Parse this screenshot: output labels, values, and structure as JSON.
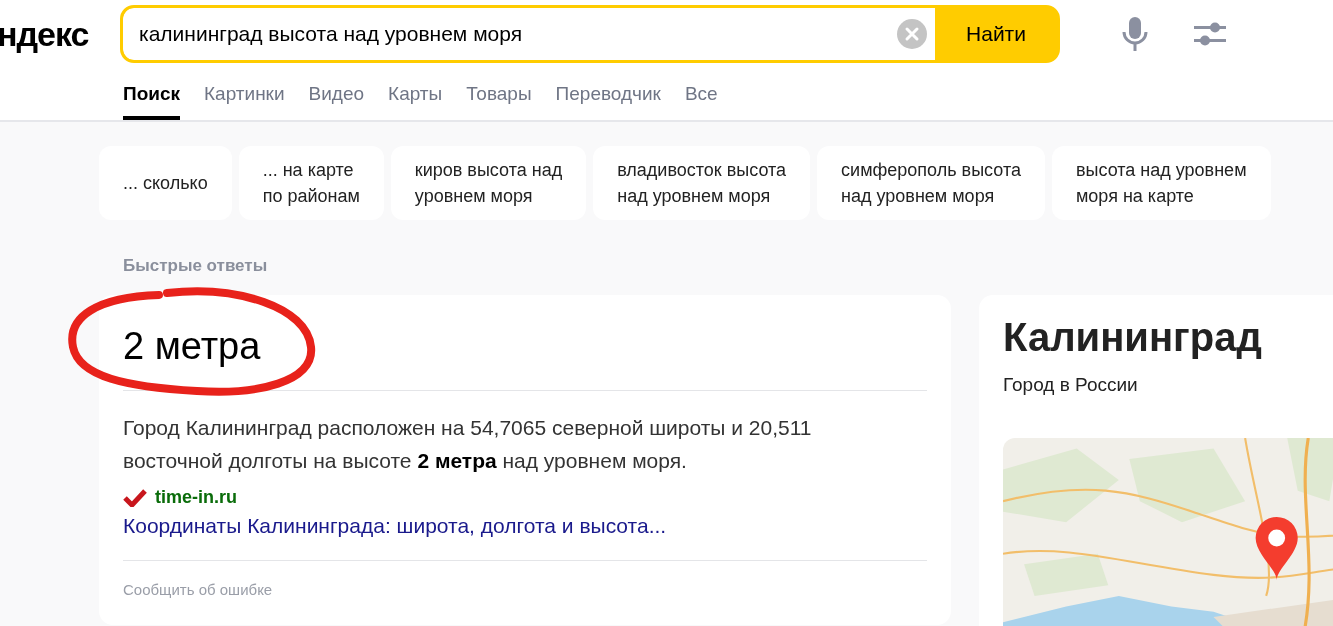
{
  "logo": "ндекс",
  "search": {
    "value": "калининград высота над уровнем моря",
    "button": "Найти"
  },
  "tabs": [
    {
      "label": "Поиск",
      "selected": true
    },
    {
      "label": "Картинки",
      "selected": false
    },
    {
      "label": "Видео",
      "selected": false
    },
    {
      "label": "Карты",
      "selected": false
    },
    {
      "label": "Товары",
      "selected": false
    },
    {
      "label": "Переводчик",
      "selected": false
    },
    {
      "label": "Все",
      "selected": false
    }
  ],
  "suggestions": [
    {
      "lines": [
        "... сколько"
      ]
    },
    {
      "lines": [
        "... на карте",
        "по районам"
      ]
    },
    {
      "lines": [
        "киров высота над",
        "уровнем моря"
      ]
    },
    {
      "lines": [
        "владивосток высота",
        "над уровнем моря"
      ]
    },
    {
      "lines": [
        "симферополь высота",
        "над уровнем моря"
      ]
    },
    {
      "lines": [
        "высота над уровнем",
        "моря на карте"
      ]
    }
  ],
  "section_title": "Быстрые ответы",
  "answer": {
    "value": "2 метра",
    "circled": true,
    "text": "Город Калининград расположен на 54,7065 северной широты и 20,511 восточной долготы на высоте **2 метра** над уровнем моря.",
    "source": "time-in.ru",
    "link": "Координаты Калининграда: широта, долгота и высота...",
    "report": "Сообщить об ошибке"
  },
  "entity": {
    "title": "Калининград",
    "subtitle": "Город в России"
  }
}
